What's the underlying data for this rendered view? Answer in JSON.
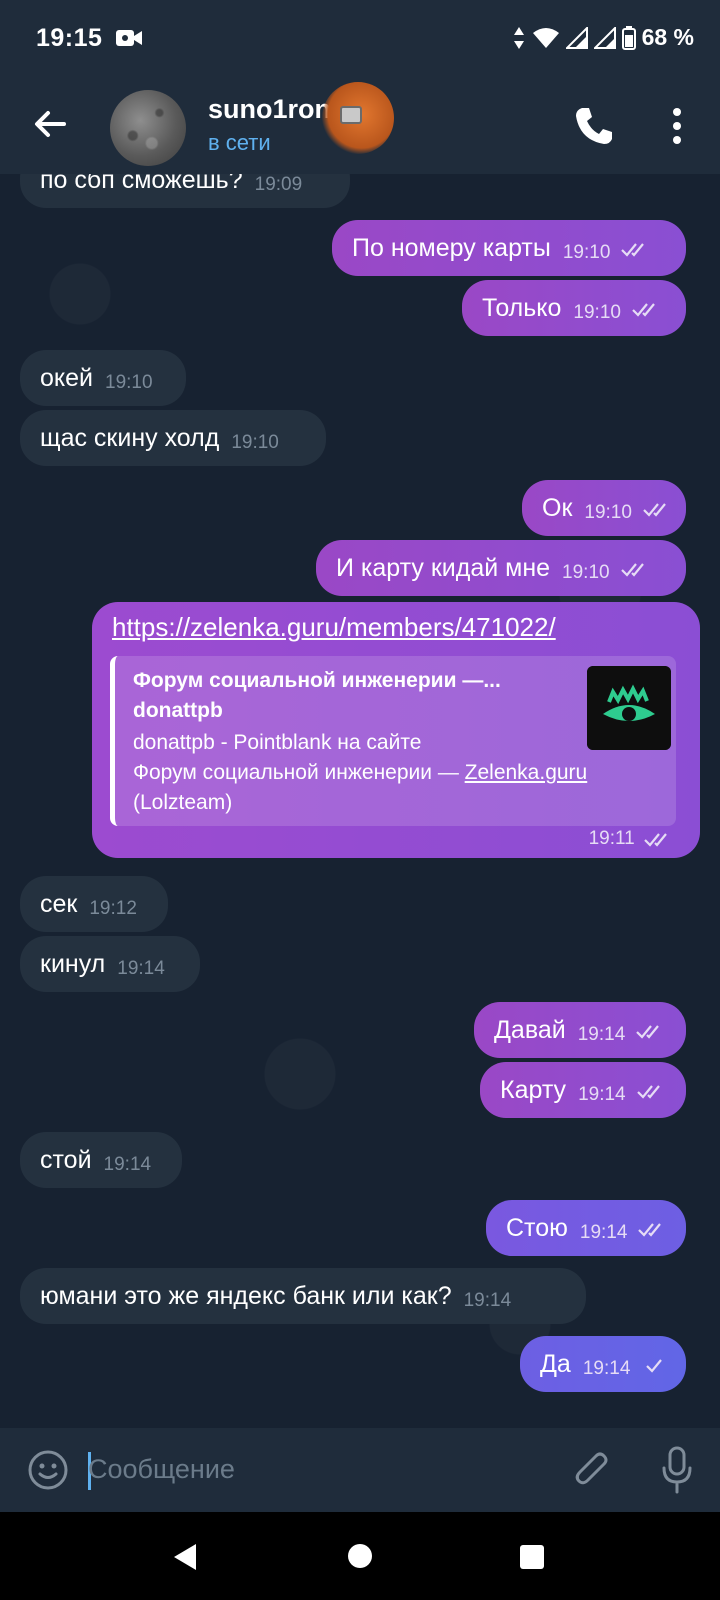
{
  "status_bar": {
    "time": "19:15",
    "battery": "68 %"
  },
  "header": {
    "contact_name": "suno1ron",
    "status": "в сети"
  },
  "messages": [
    {
      "dir": "in",
      "text": "по сбп сможешь?",
      "time": "19:09"
    },
    {
      "dir": "out",
      "text": "По номеру карты",
      "time": "19:10",
      "read": true
    },
    {
      "dir": "out",
      "text": "Только",
      "time": "19:10",
      "read": true
    },
    {
      "dir": "in",
      "text": "окей",
      "time": "19:10"
    },
    {
      "dir": "in",
      "text": "щас скину холд",
      "time": "19:10"
    },
    {
      "dir": "out",
      "text": "Ок",
      "time": "19:10",
      "read": true
    },
    {
      "dir": "out",
      "text": "И карту кидай мне",
      "time": "19:10",
      "read": true
    },
    {
      "dir": "in",
      "text": "сек",
      "time": "19:12"
    },
    {
      "dir": "in",
      "text": "кинул",
      "time": "19:14"
    },
    {
      "dir": "out",
      "text": "Давай",
      "time": "19:14",
      "read": true
    },
    {
      "dir": "out",
      "text": "Карту",
      "time": "19:14",
      "read": true
    },
    {
      "dir": "in",
      "text": "стой",
      "time": "19:14"
    },
    {
      "dir": "out",
      "text": "Стою",
      "time": "19:14",
      "read": true
    },
    {
      "dir": "in",
      "text": "юмани это же яндекс банк или как?",
      "time": "19:14"
    },
    {
      "dir": "out",
      "text": "Да",
      "time": "19:14",
      "read": false
    }
  ],
  "link_message": {
    "url": "https://zelenka.guru/members/471022/",
    "preview_title_line1": "Форум социальной инженерии —...",
    "preview_title_line2": "donattpb",
    "preview_desc_line1": "donattpb - Pointblank на сайте",
    "preview_desc_line2_prefix": "Форум социальной инженерии — ",
    "preview_desc_link": "Zelenka.guru",
    "preview_desc_line3": "(Lolzteam)",
    "time": "19:11"
  },
  "composer": {
    "placeholder": "Сообщение"
  },
  "colors": {
    "accent": "#5fb1ef",
    "outgoing_bubble": "#9a48c6",
    "incoming_bubble": "#24313f"
  }
}
